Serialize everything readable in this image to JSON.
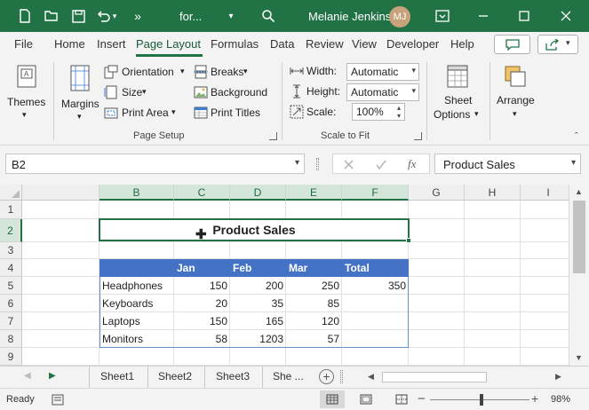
{
  "titlebar": {
    "filename": "for...",
    "user": "Melanie Jenkins",
    "initials": "MJ",
    "more": "»"
  },
  "menu": {
    "file": "File",
    "home": "Home",
    "insert": "Insert",
    "page_layout": "Page Layout",
    "formulas": "Formulas",
    "data": "Data",
    "review": "Review",
    "view": "View",
    "developer": "Developer",
    "help": "Help"
  },
  "ribbon": {
    "themes": "Themes",
    "margins": "Margins",
    "orientation": "Orientation",
    "size": "Size",
    "print_area": "Print Area",
    "breaks": "Breaks",
    "background": "Background",
    "print_titles": "Print Titles",
    "page_setup": "Page Setup",
    "width": "Width:",
    "width_value": "Automatic",
    "height": "Height:",
    "height_value": "Automatic",
    "scale": "Scale:",
    "scale_value": "100%",
    "scale_to_fit": "Scale to Fit",
    "sheet_options_1": "Sheet",
    "sheet_options_2": "Options",
    "arrange": "Arrange"
  },
  "formula_bar": {
    "name_box": "B2",
    "fx": "fx",
    "content": "Product Sales"
  },
  "columns": [
    "B",
    "C",
    "D",
    "E",
    "F",
    "G",
    "H",
    "I"
  ],
  "rows": [
    "1",
    "2",
    "3",
    "4",
    "5",
    "6",
    "7",
    "8",
    "9"
  ],
  "sheet": {
    "title": "Product Sales",
    "headers": [
      "",
      "Jan",
      "Feb",
      "Mar",
      "Total"
    ],
    "data": [
      [
        "Headphones",
        "150",
        "200",
        "250",
        "350"
      ],
      [
        "Keyboards",
        "20",
        "35",
        "85",
        ""
      ],
      [
        "Laptops",
        "150",
        "165",
        "120",
        ""
      ],
      [
        "Monitors",
        "58",
        "1203",
        "57",
        ""
      ]
    ]
  },
  "sheets": [
    "Sheet1",
    "Sheet2",
    "Sheet3",
    "She ..."
  ],
  "status": {
    "ready": "Ready",
    "zoom": "98%",
    "minus": "−",
    "plus": "+"
  },
  "colors": {
    "excel_green": "#217346",
    "header_blue": "#4472c4"
  }
}
